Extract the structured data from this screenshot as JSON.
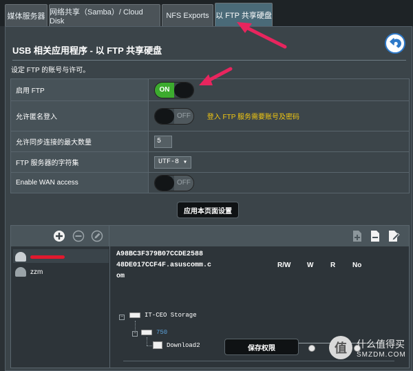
{
  "tabs": [
    {
      "label": "媒体服务器"
    },
    {
      "label": "网络共享（Samba）/ Cloud Disk"
    },
    {
      "label": "NFS Exports"
    },
    {
      "label": "以 FTP 共享硬盘"
    }
  ],
  "page": {
    "title": "USB 相关应用程序 - 以 FTP 共享硬盘",
    "subtitle": "设定 FTP 的账号与许可。"
  },
  "settings": {
    "enable_ftp": {
      "label": "启用 FTP",
      "state": "ON"
    },
    "anonymous": {
      "label": "允许匿名登入",
      "state": "OFF",
      "hint": "登入 FTP 服务需要账号及密码"
    },
    "max_conn": {
      "label": "允许同步连接的最大数量",
      "value": "5"
    },
    "charset": {
      "label": "FTP 服务器的字符集",
      "value": "UTF-8",
      "caret": "▾"
    },
    "wan": {
      "label": "Enable WAN access",
      "state": "OFF"
    }
  },
  "apply_label": "应用本页面设置",
  "accounts": {
    "users": [
      {
        "name": ""
      },
      {
        "name": "zzm"
      }
    ],
    "ddns_lines": [
      "A98BC3F379B07CCDE2588",
      "48DE017CCF4F.asuscomm.c",
      "om"
    ],
    "perm_headers": [
      "R/W",
      "W",
      "R",
      "No"
    ],
    "storage": "IT-CEO Storage",
    "partition": "750",
    "folder": "Download2",
    "selected_permission": "R/W",
    "save_label": "保存权限"
  },
  "watermark": {
    "cn": "什么值得买",
    "en": "SMZDM.COM",
    "logo_char": "值"
  },
  "colors": {
    "switch_on": "#3cab2e",
    "hint": "#f2c811",
    "arrow": "#e8255e",
    "active_tab": "#4a6a78"
  },
  "icons": {
    "back": "back-arrow-icon",
    "add": "plus-circle-icon",
    "remove": "minus-circle-icon",
    "edit": "pencil-circle-icon",
    "toolbar": [
      "add-folder-icon",
      "delete-folder-icon",
      "rename-folder-icon"
    ]
  }
}
